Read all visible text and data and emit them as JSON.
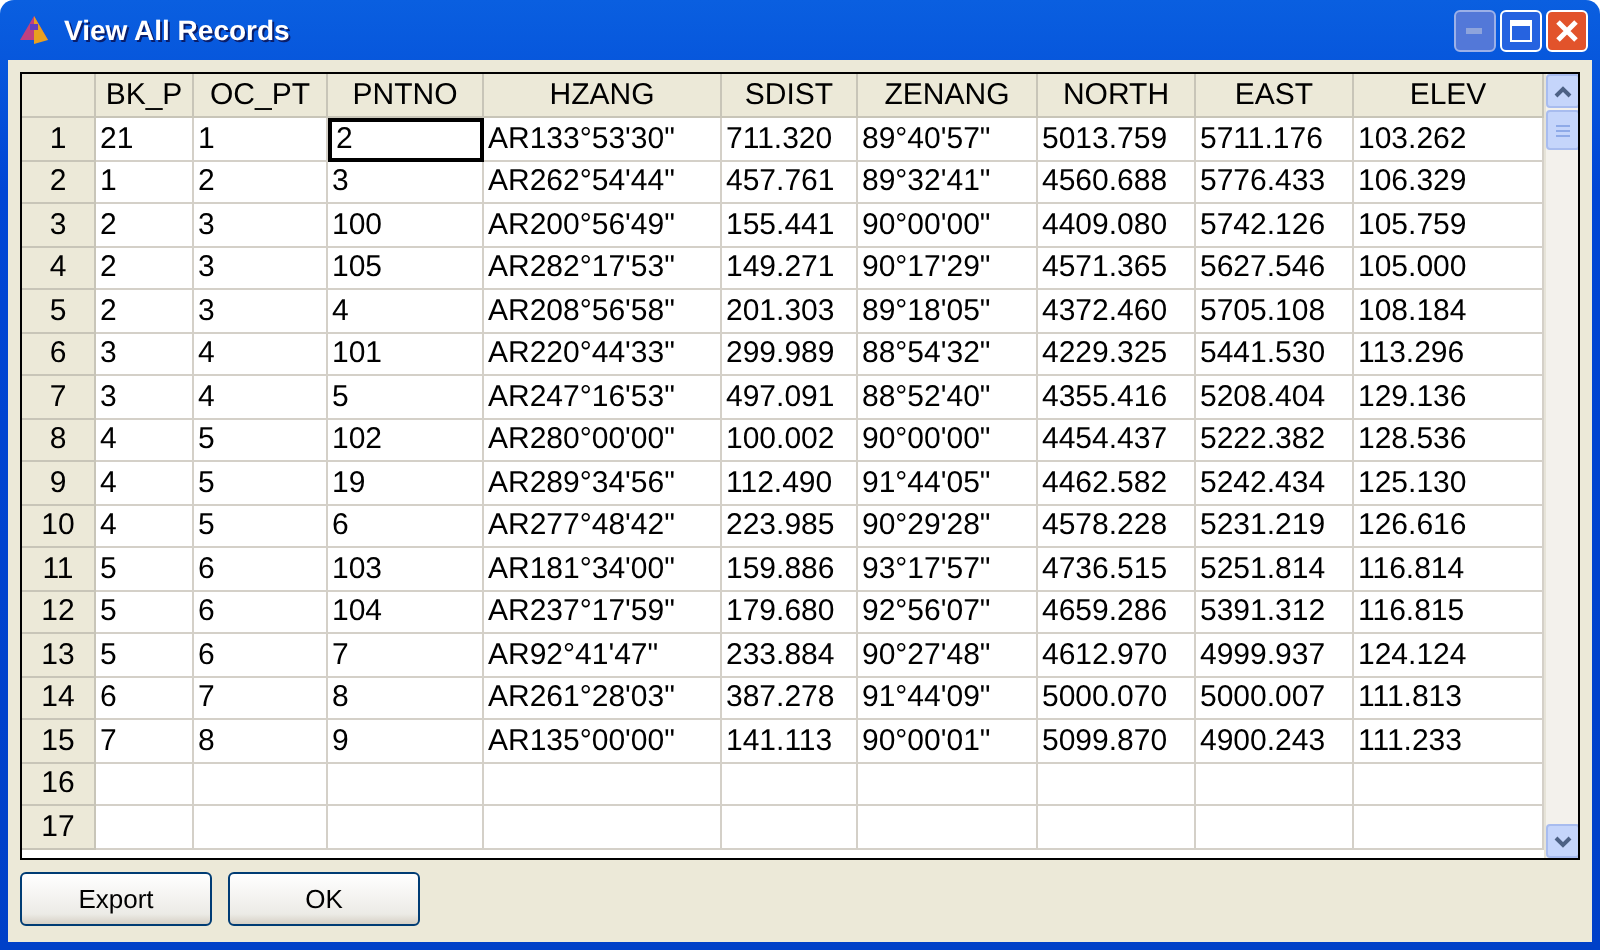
{
  "window": {
    "title": "View All Records"
  },
  "table": {
    "columns": [
      "BK_P",
      "OC_PT",
      "PNTNO",
      "HZANG",
      "SDIST",
      "ZENANG",
      "NORTH",
      "EAST",
      "ELEV"
    ],
    "rows": [
      {
        "number": "1",
        "cells": [
          {
            "text": "21",
            "selected": false
          },
          {
            "text": "1",
            "selected": false
          },
          {
            "text": "2",
            "selected": true
          },
          {
            "text": "AR133°53'30\"",
            "selected": false
          },
          {
            "text": "711.320",
            "selected": false
          },
          {
            "text": "89°40'57\"",
            "selected": false
          },
          {
            "text": "5013.759",
            "selected": false
          },
          {
            "text": "5711.176",
            "selected": false
          },
          {
            "text": "103.262",
            "selected": false
          }
        ]
      },
      {
        "number": "2",
        "cells": [
          {
            "text": "1",
            "selected": false
          },
          {
            "text": "2",
            "selected": false
          },
          {
            "text": "3",
            "selected": false
          },
          {
            "text": "AR262°54'44\"",
            "selected": false
          },
          {
            "text": "457.761",
            "selected": false
          },
          {
            "text": "89°32'41\"",
            "selected": false
          },
          {
            "text": "4560.688",
            "selected": false
          },
          {
            "text": "5776.433",
            "selected": false
          },
          {
            "text": "106.329",
            "selected": false
          }
        ]
      },
      {
        "number": "3",
        "cells": [
          {
            "text": "2",
            "selected": false
          },
          {
            "text": "3",
            "selected": false
          },
          {
            "text": "100",
            "selected": false
          },
          {
            "text": "AR200°56'49\"",
            "selected": false
          },
          {
            "text": "155.441",
            "selected": false
          },
          {
            "text": "90°00'00\"",
            "selected": false
          },
          {
            "text": "4409.080",
            "selected": false
          },
          {
            "text": "5742.126",
            "selected": false
          },
          {
            "text": "105.759",
            "selected": false
          }
        ]
      },
      {
        "number": "4",
        "cells": [
          {
            "text": "2",
            "selected": false
          },
          {
            "text": "3",
            "selected": false
          },
          {
            "text": "105",
            "selected": false
          },
          {
            "text": "AR282°17'53\"",
            "selected": false
          },
          {
            "text": "149.271",
            "selected": false
          },
          {
            "text": "90°17'29\"",
            "selected": false
          },
          {
            "text": "4571.365",
            "selected": false
          },
          {
            "text": "5627.546",
            "selected": false
          },
          {
            "text": "105.000",
            "selected": false
          }
        ]
      },
      {
        "number": "5",
        "cells": [
          {
            "text": "2",
            "selected": false
          },
          {
            "text": "3",
            "selected": false
          },
          {
            "text": "4",
            "selected": false
          },
          {
            "text": "AR208°56'58\"",
            "selected": false
          },
          {
            "text": "201.303",
            "selected": false
          },
          {
            "text": "89°18'05\"",
            "selected": false
          },
          {
            "text": "4372.460",
            "selected": false
          },
          {
            "text": "5705.108",
            "selected": false
          },
          {
            "text": "108.184",
            "selected": false
          }
        ]
      },
      {
        "number": "6",
        "cells": [
          {
            "text": "3",
            "selected": false
          },
          {
            "text": "4",
            "selected": false
          },
          {
            "text": "101",
            "selected": false
          },
          {
            "text": "AR220°44'33\"",
            "selected": false
          },
          {
            "text": "299.989",
            "selected": false
          },
          {
            "text": "88°54'32\"",
            "selected": false
          },
          {
            "text": "4229.325",
            "selected": false
          },
          {
            "text": "5441.530",
            "selected": false
          },
          {
            "text": "113.296",
            "selected": false
          }
        ]
      },
      {
        "number": "7",
        "cells": [
          {
            "text": "3",
            "selected": false
          },
          {
            "text": "4",
            "selected": false
          },
          {
            "text": "5",
            "selected": false
          },
          {
            "text": "AR247°16'53\"",
            "selected": false
          },
          {
            "text": "497.091",
            "selected": false
          },
          {
            "text": "88°52'40\"",
            "selected": false
          },
          {
            "text": "4355.416",
            "selected": false
          },
          {
            "text": "5208.404",
            "selected": false
          },
          {
            "text": "129.136",
            "selected": false
          }
        ]
      },
      {
        "number": "8",
        "cells": [
          {
            "text": "4",
            "selected": false
          },
          {
            "text": "5",
            "selected": false
          },
          {
            "text": "102",
            "selected": false
          },
          {
            "text": "AR280°00'00\"",
            "selected": false
          },
          {
            "text": "100.002",
            "selected": false
          },
          {
            "text": "90°00'00\"",
            "selected": false
          },
          {
            "text": "4454.437",
            "selected": false
          },
          {
            "text": "5222.382",
            "selected": false
          },
          {
            "text": "128.536",
            "selected": false
          }
        ]
      },
      {
        "number": "9",
        "cells": [
          {
            "text": "4",
            "selected": false
          },
          {
            "text": "5",
            "selected": false
          },
          {
            "text": "19",
            "selected": false
          },
          {
            "text": "AR289°34'56\"",
            "selected": false
          },
          {
            "text": "112.490",
            "selected": false
          },
          {
            "text": "91°44'05\"",
            "selected": false
          },
          {
            "text": "4462.582",
            "selected": false
          },
          {
            "text": "5242.434",
            "selected": false
          },
          {
            "text": "125.130",
            "selected": false
          }
        ]
      },
      {
        "number": "10",
        "cells": [
          {
            "text": "4",
            "selected": false
          },
          {
            "text": "5",
            "selected": false
          },
          {
            "text": "6",
            "selected": false
          },
          {
            "text": "AR277°48'42\"",
            "selected": false
          },
          {
            "text": "223.985",
            "selected": false
          },
          {
            "text": "90°29'28\"",
            "selected": false
          },
          {
            "text": "4578.228",
            "selected": false
          },
          {
            "text": "5231.219",
            "selected": false
          },
          {
            "text": "126.616",
            "selected": false
          }
        ]
      },
      {
        "number": "11",
        "cells": [
          {
            "text": "5",
            "selected": false
          },
          {
            "text": "6",
            "selected": false
          },
          {
            "text": "103",
            "selected": false
          },
          {
            "text": "AR181°34'00\"",
            "selected": false
          },
          {
            "text": "159.886",
            "selected": false
          },
          {
            "text": "93°17'57\"",
            "selected": false
          },
          {
            "text": "4736.515",
            "selected": false
          },
          {
            "text": "5251.814",
            "selected": false
          },
          {
            "text": "116.814",
            "selected": false
          }
        ]
      },
      {
        "number": "12",
        "cells": [
          {
            "text": "5",
            "selected": false
          },
          {
            "text": "6",
            "selected": false
          },
          {
            "text": "104",
            "selected": false
          },
          {
            "text": "AR237°17'59\"",
            "selected": false
          },
          {
            "text": "179.680",
            "selected": false
          },
          {
            "text": "92°56'07\"",
            "selected": false
          },
          {
            "text": "4659.286",
            "selected": false
          },
          {
            "text": "5391.312",
            "selected": false
          },
          {
            "text": "116.815",
            "selected": false
          }
        ]
      },
      {
        "number": "13",
        "cells": [
          {
            "text": "5",
            "selected": false
          },
          {
            "text": "6",
            "selected": false
          },
          {
            "text": "7",
            "selected": false
          },
          {
            "text": "AR92°41'47\"",
            "selected": false
          },
          {
            "text": "233.884",
            "selected": false
          },
          {
            "text": "90°27'48\"",
            "selected": false
          },
          {
            "text": "4612.970",
            "selected": false
          },
          {
            "text": "4999.937",
            "selected": false
          },
          {
            "text": "124.124",
            "selected": false
          }
        ]
      },
      {
        "number": "14",
        "cells": [
          {
            "text": "6",
            "selected": false
          },
          {
            "text": "7",
            "selected": false
          },
          {
            "text": "8",
            "selected": false
          },
          {
            "text": "AR261°28'03\"",
            "selected": false
          },
          {
            "text": "387.278",
            "selected": false
          },
          {
            "text": "91°44'09\"",
            "selected": false
          },
          {
            "text": "5000.070",
            "selected": false
          },
          {
            "text": "5000.007",
            "selected": false
          },
          {
            "text": "111.813",
            "selected": false
          }
        ]
      },
      {
        "number": "15",
        "cells": [
          {
            "text": "7",
            "selected": false
          },
          {
            "text": "8",
            "selected": false
          },
          {
            "text": "9",
            "selected": false
          },
          {
            "text": "AR135°00'00\"",
            "selected": false
          },
          {
            "text": "141.113",
            "selected": false
          },
          {
            "text": "90°00'01\"",
            "selected": false
          },
          {
            "text": "5099.870",
            "selected": false
          },
          {
            "text": "4900.243",
            "selected": false
          },
          {
            "text": "111.233",
            "selected": false
          }
        ]
      },
      {
        "number": "16"
      },
      {
        "number": "17"
      }
    ]
  },
  "buttons": [
    "Export",
    "OK"
  ]
}
